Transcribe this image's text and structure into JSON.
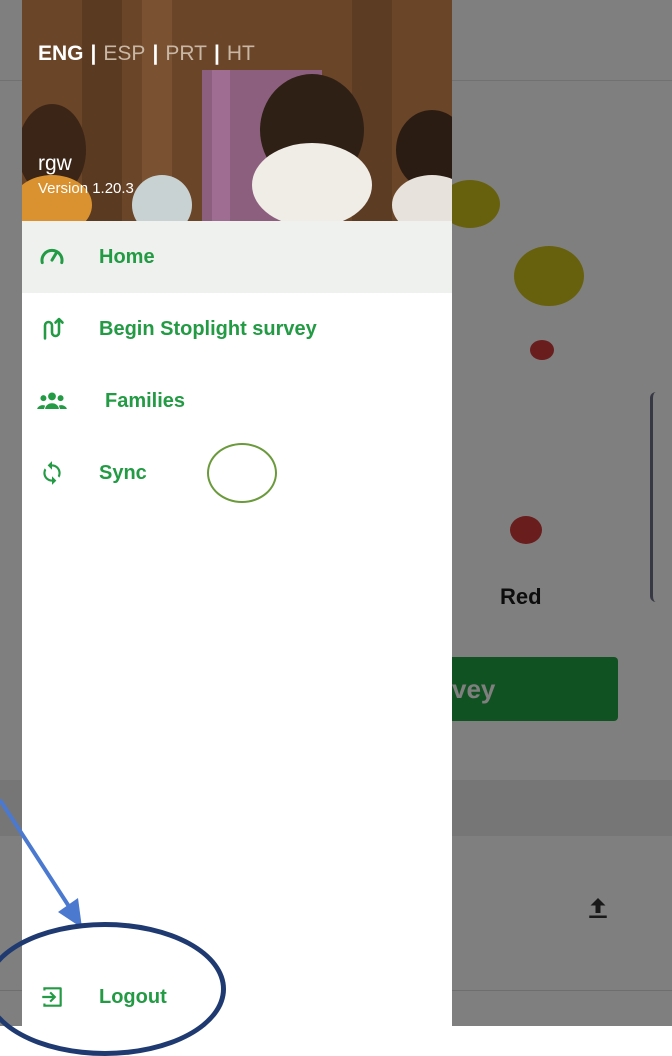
{
  "background": {
    "dot_label": "Red",
    "button_text_fragment": "vey",
    "colors": {
      "yellow": "#cfc21c",
      "red": "#d23a3a",
      "green": "#23a544"
    },
    "icons": {
      "upload": "upload-icon"
    }
  },
  "drawer": {
    "languages": [
      {
        "code": "ENG",
        "active": true
      },
      {
        "code": "ESP",
        "active": false
      },
      {
        "code": "PRT",
        "active": false
      },
      {
        "code": "HT",
        "active": false
      }
    ],
    "user": {
      "name": "rgw",
      "version": "Version 1.20.3"
    },
    "menu": [
      {
        "label": "Home",
        "icon": "dashboard-gauge-icon",
        "active": true
      },
      {
        "label": "Begin Stoplight survey",
        "icon": "route-icon",
        "active": false
      },
      {
        "label": "Families",
        "icon": "group-icon",
        "active": false
      },
      {
        "label": "Sync",
        "icon": "sync-icon",
        "active": false
      }
    ],
    "logout": {
      "label": "Logout",
      "icon": "logout-icon"
    },
    "accent_color": "#239a44"
  }
}
